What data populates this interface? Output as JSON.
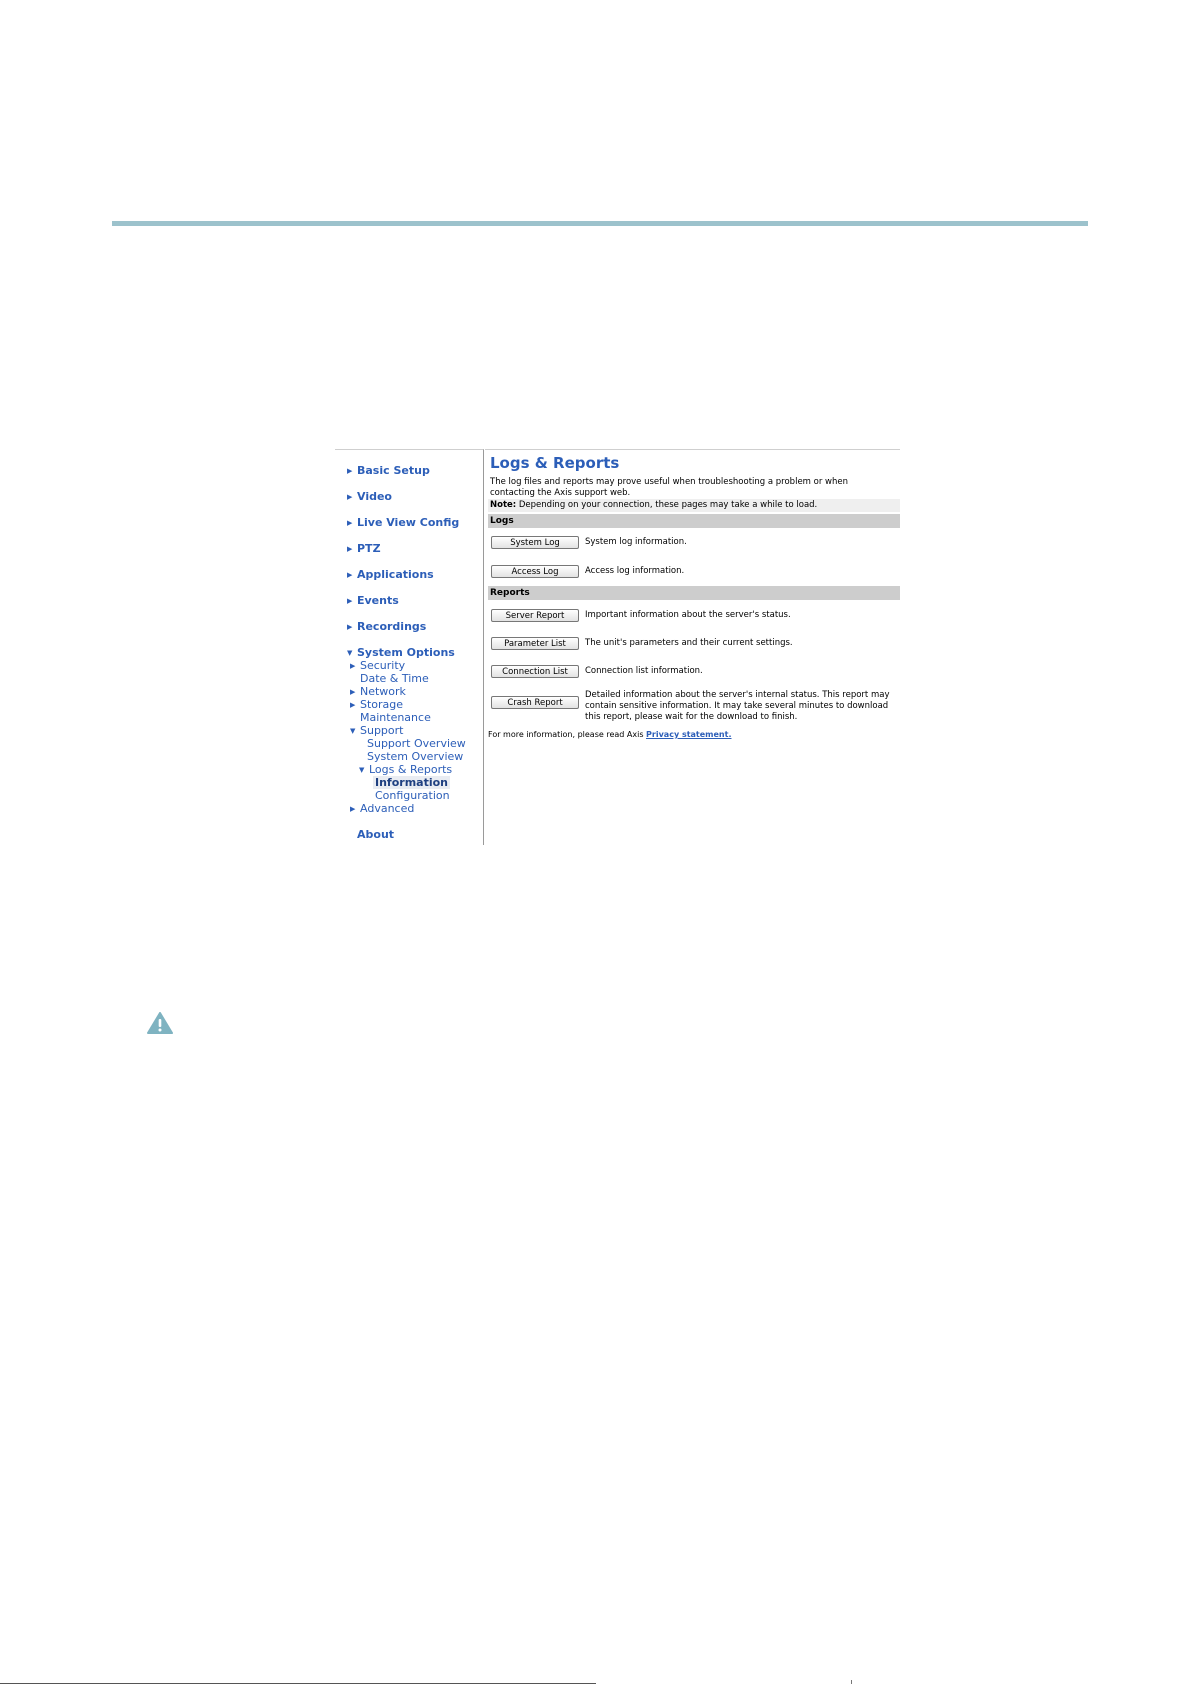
{
  "colors": {
    "rule": "#9cc2cc",
    "link": "#2c5eb8",
    "section_bar": "#cdcdcd",
    "note_bar": "#efefef",
    "warning": "#7fb3c1"
  },
  "warning_icon": "warning-triangle-icon",
  "sidebar": {
    "items": [
      {
        "label": "Basic Setup",
        "icon": "arrow-right-icon"
      },
      {
        "label": "Video",
        "icon": "arrow-right-icon"
      },
      {
        "label": "Live View Config",
        "icon": "arrow-right-icon"
      },
      {
        "label": "PTZ",
        "icon": "arrow-right-icon"
      },
      {
        "label": "Applications",
        "icon": "arrow-right-icon"
      },
      {
        "label": "Events",
        "icon": "arrow-right-icon"
      },
      {
        "label": "Recordings",
        "icon": "arrow-right-icon"
      },
      {
        "label": "System Options",
        "icon": "arrow-down-icon"
      }
    ],
    "system_options": {
      "security": "Security",
      "date_time": "Date & Time",
      "network": "Network",
      "storage": "Storage",
      "maintenance": "Maintenance",
      "support": "Support",
      "support_overview": "Support Overview",
      "system_overview": "System Overview",
      "logs_reports": "Logs & Reports",
      "information": "Information",
      "configuration": "Configuration",
      "advanced": "Advanced"
    },
    "about": "About"
  },
  "content": {
    "title": "Logs & Reports",
    "intro": "The log files and reports may prove useful when troubleshooting a problem or when contacting the Axis support web.",
    "note_label": "Note:",
    "note_text": " Depending on your connection, these pages may take a while to load.",
    "logs_header": "Logs",
    "logs": [
      {
        "button": "System Log",
        "desc": "System log information."
      },
      {
        "button": "Access Log",
        "desc": "Access log information."
      }
    ],
    "reports_header": "Reports",
    "reports": [
      {
        "button": "Server Report",
        "desc": "Important information about the server's status."
      },
      {
        "button": "Parameter List",
        "desc": "The unit's parameters and their current settings."
      },
      {
        "button": "Connection List",
        "desc": "Connection list information."
      },
      {
        "button": "Crash Report",
        "desc": "Detailed information about the server's internal status. This report may contain sensitive information. It may take several minutes to download this report, please wait for the download to finish."
      }
    ],
    "footer_text": "For more information, please read Axis ",
    "footer_link": "Privacy statement."
  }
}
